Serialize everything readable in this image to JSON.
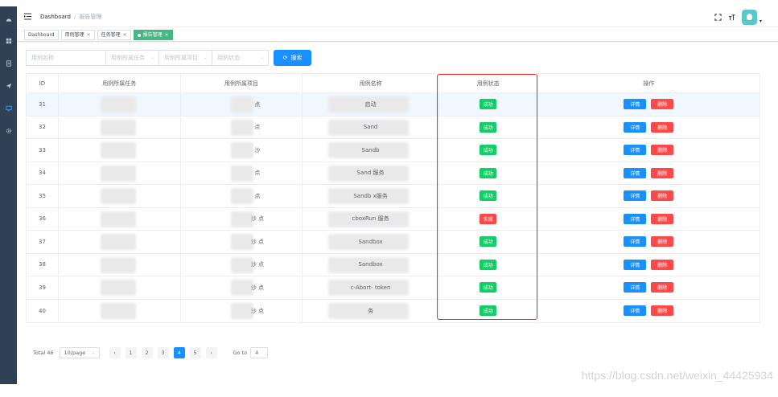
{
  "breadcrumb": {
    "first": "Dashboard",
    "separator": "/",
    "current": "报告管理"
  },
  "tags": [
    {
      "label": "Dashboard",
      "closable": false,
      "active": false
    },
    {
      "label": "用例管理",
      "closable": true,
      "active": false
    },
    {
      "label": "任务管理",
      "closable": true,
      "active": false
    },
    {
      "label": "报告管理",
      "closable": true,
      "active": true
    }
  ],
  "filters": {
    "case_name_placeholder": "用例名称",
    "task_placeholder": "用例所属任务",
    "project_placeholder": "用例所属项目",
    "status_placeholder": "用例状态",
    "search_label": "搜索"
  },
  "table": {
    "headers": [
      "ID",
      "用例所属任务",
      "用例所属项目",
      "用例名称",
      "用例状态",
      "操作"
    ],
    "rows": [
      {
        "id": "31",
        "project": "点",
        "name": "启动",
        "status": "成功",
        "state": "ok"
      },
      {
        "id": "32",
        "project": "点",
        "name": "Sand",
        "status": "成功",
        "state": "ok"
      },
      {
        "id": "33",
        "project": "沙",
        "name": "Sandb",
        "status": "成功",
        "state": "ok"
      },
      {
        "id": "34",
        "project": "点",
        "name": "Sand 服务",
        "status": "成功",
        "state": "ok"
      },
      {
        "id": "35",
        "project": "点",
        "name": "Sandb x服务",
        "status": "成功",
        "state": "ok"
      },
      {
        "id": "36",
        "project": "沙 点",
        "name": "cboxRun 服务",
        "status": "失败",
        "state": "fail"
      },
      {
        "id": "37",
        "project": "沙 点",
        "name": "Sandbox",
        "status": "成功",
        "state": "ok"
      },
      {
        "id": "38",
        "project": "沙 点",
        "name": "Sandbox",
        "status": "成功",
        "state": "ok"
      },
      {
        "id": "39",
        "project": "沙 点",
        "name": "c-Abort- token",
        "status": "成功",
        "state": "ok"
      },
      {
        "id": "40",
        "project": "沙 点",
        "name": "务",
        "status": "成功",
        "state": "ok"
      }
    ],
    "detail_label": "详情",
    "delete_label": "删除"
  },
  "pagination": {
    "total": "Total 46",
    "page_size": "10/page",
    "prev": "‹",
    "next": "›",
    "pages": [
      "1",
      "2",
      "3",
      "4",
      "5"
    ],
    "current_page": "4",
    "goto_label": "Go to",
    "goto_value": "4"
  },
  "watermark": "https://blog.csdn.net/weixin_44425934",
  "colors": {
    "sidebar": "#304156",
    "primary": "#1890ff",
    "success": "#13ce66",
    "danger": "#ff4949",
    "tag_active": "#42b983",
    "highlight_box": "#e62e2e"
  }
}
